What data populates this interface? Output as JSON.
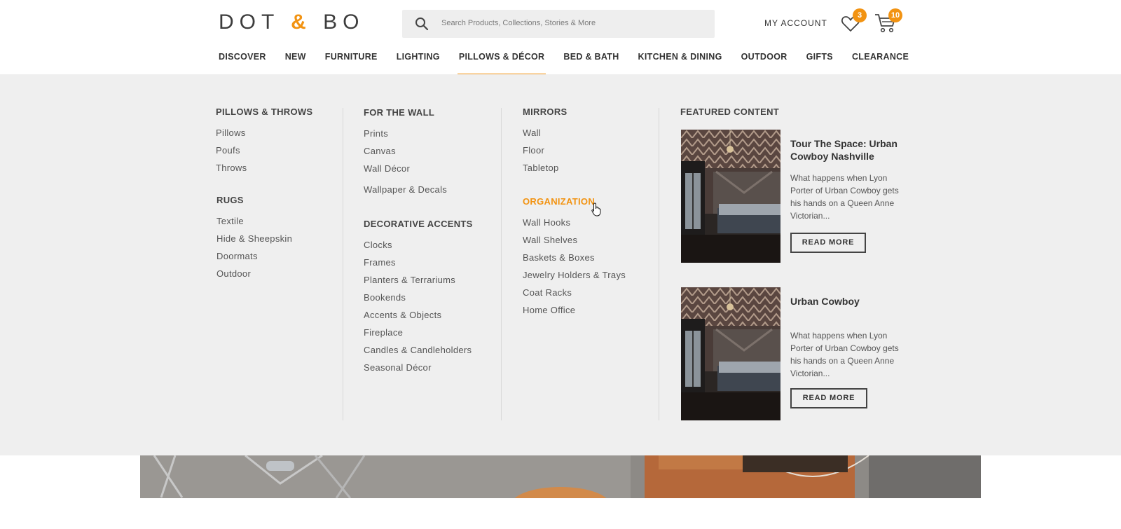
{
  "brand": {
    "logo_left": "DOT",
    "logo_amp": "&",
    "logo_right": "BO"
  },
  "search": {
    "placeholder": "Search Products, Collections, Stories & More"
  },
  "header": {
    "account_label": "MY ACCOUNT",
    "wishlist_count": "3",
    "cart_count": "10"
  },
  "nav": {
    "items": [
      "DISCOVER",
      "NEW",
      "FURNITURE",
      "LIGHTING",
      "PILLOWS & DÉCOR",
      "BED & BATH",
      "KITCHEN & DINING",
      "OUTDOOR",
      "GIFTS",
      "CLEARANCE"
    ],
    "active": "PILLOWS & DÉCOR"
  },
  "menu": {
    "pillows_throws": {
      "heading": "PILLOWS & THROWS",
      "links": [
        "Pillows",
        "Poufs",
        "Throws"
      ]
    },
    "rugs": {
      "heading": "RUGS",
      "links": [
        "Textile",
        "Hide & Sheepskin",
        "Doormats",
        "Outdoor"
      ]
    },
    "wall": {
      "heading": "FOR THE WALL",
      "links": [
        "Prints",
        "Canvas",
        "Wall Décor",
        "Wallpaper & Decals"
      ]
    },
    "accents": {
      "heading": "DECORATIVE ACCENTS",
      "links": [
        "Clocks",
        "Frames",
        "Planters & Terrariums",
        "Bookends",
        "Accents & Objects",
        "Fireplace",
        "Candles & Candleholders",
        "Seasonal Décor"
      ]
    },
    "mirrors": {
      "heading": "MIRRORS",
      "links": [
        "Wall",
        "Floor",
        "Tabletop"
      ]
    },
    "organization": {
      "heading": "ORGANIZATION",
      "links": [
        "Wall Hooks",
        "Wall Shelves",
        "Baskets & Boxes",
        "Jewelry Holders & Trays",
        "Coat Racks",
        "Home Office"
      ]
    },
    "featured": {
      "heading": "FEATURED CONTENT",
      "items": [
        {
          "title": "Tour The Space: Urban Cowboy Nashville",
          "text": "What happens when Lyon Porter of Urban Cowboy gets his hands on a Queen Anne Victorian...",
          "button": "READ MORE"
        },
        {
          "title": "Urban Cowboy",
          "text": "What happens when Lyon Porter of Urban Cowboy gets his hands on a Queen Anne Victorian...",
          "button": "READ MORE"
        }
      ]
    }
  },
  "colors": {
    "accent": "#f29312",
    "menu_bg": "#efefef",
    "search_bg": "#eeeeee"
  }
}
